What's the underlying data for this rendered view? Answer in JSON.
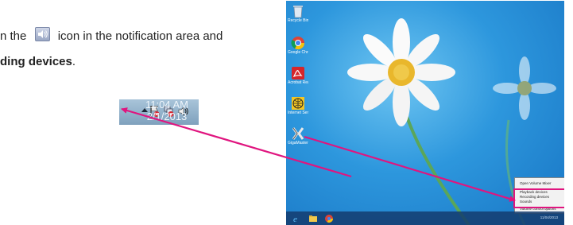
{
  "instructions": {
    "line1_start": "n the",
    "line1_end": "icon in the notification area and",
    "line2_bold": "ding devices",
    "line2_end": "."
  },
  "tray": {
    "time": "11:04 AM",
    "date": "2/1/2013"
  },
  "desktop": {
    "icons": [
      {
        "label": "Recycle Bin",
        "icon": "recycle-bin-icon"
      },
      {
        "label": "Google Chrome",
        "icon": "chrome-icon"
      },
      {
        "label": "Acrobat Reader",
        "icon": "acrobat-icon"
      },
      {
        "label": "Internet Service",
        "icon": "globe-icon"
      },
      {
        "label": "GigaMaster Wizard",
        "icon": "gigamaster-icon"
      }
    ],
    "context_menu": [
      "Open Volume Mixer",
      "Playback devices",
      "Recording devices",
      "Sounds",
      "Volume control options"
    ],
    "taskbar_date": "11/04/2013"
  },
  "colors": {
    "arrow": "#e0157f",
    "desktop_bg": "#2d97dd"
  }
}
